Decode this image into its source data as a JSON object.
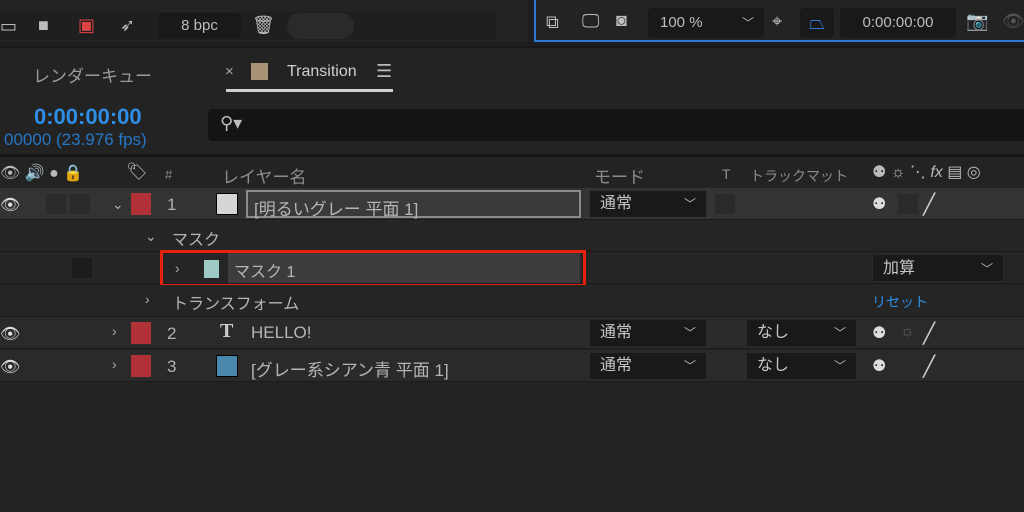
{
  "toolbar": {
    "bpc": "8 bpc",
    "zoom": "100 %",
    "timecode": "0:00:00:00"
  },
  "tabs": {
    "render_queue": "レンダーキュー",
    "active": "Transition",
    "active_color": "#a89374"
  },
  "timecode": {
    "main": "0:00:00:00",
    "sub": "00000 (23.976 fps)"
  },
  "columns": {
    "num": "#",
    "layer_name": "レイヤー名",
    "mode": "モード",
    "t": "T",
    "track_matte": "トラックマット",
    "fx": "fx"
  },
  "layers": [
    {
      "num": "1",
      "name": "[明るいグレー 平面 1]",
      "mode": "通常",
      "color": "#d6d6d6",
      "expanded": true
    },
    {
      "num": "2",
      "name": "HELLO!",
      "mode": "通常",
      "matte": "なし",
      "type_icon": "T"
    },
    {
      "num": "3",
      "name": "[グレー系シアン青 平面 1]",
      "mode": "通常",
      "matte": "なし",
      "color": "#4a87ad"
    }
  ],
  "masks": {
    "group": "マスク",
    "mask1": "マスク 1",
    "mask1_color": "#9ec9c4",
    "mask1_mode": "加算",
    "transform": "トランスフォーム",
    "reset": "リセット"
  }
}
